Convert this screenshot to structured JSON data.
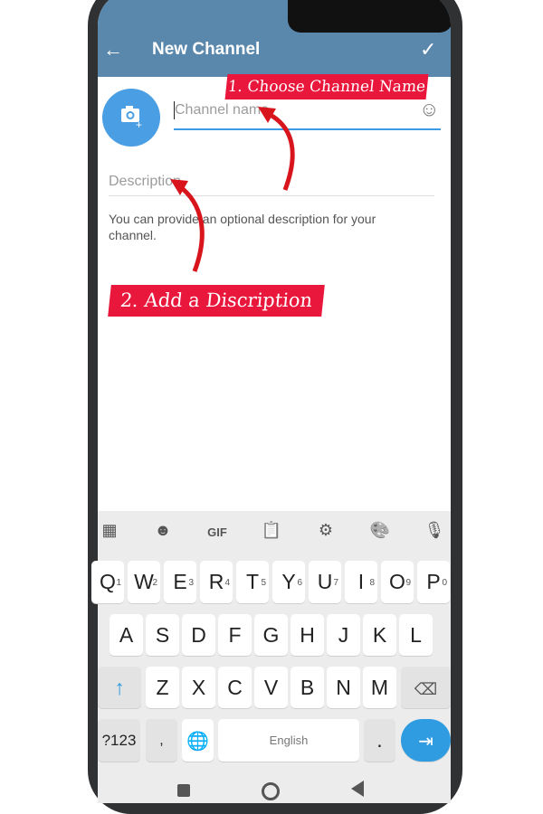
{
  "header": {
    "title": "New Channel",
    "back_icon": "arrow-left-icon",
    "confirm_icon": "check-icon",
    "color": "#5a87ac"
  },
  "form": {
    "channel_name_placeholder": "Channel name",
    "description_placeholder": "Description",
    "help_text": "You can provide an optional description for your channel."
  },
  "annotations": {
    "step1": "1. Choose Channel Name",
    "step2": "2. Add a Discription",
    "color": "#e8173b"
  },
  "keyboard": {
    "toolbar": [
      "apps-icon",
      "sticker-icon",
      "GIF",
      "clipboard-icon",
      "settings-icon",
      "palette-icon",
      "mic-icon"
    ],
    "row1": [
      [
        "Q",
        "1"
      ],
      [
        "W",
        "2"
      ],
      [
        "E",
        "3"
      ],
      [
        "R",
        "4"
      ],
      [
        "T",
        "5"
      ],
      [
        "Y",
        "6"
      ],
      [
        "U",
        "7"
      ],
      [
        "I",
        "8"
      ],
      [
        "O",
        "9"
      ],
      [
        "P",
        "0"
      ]
    ],
    "row2": [
      "A",
      "S",
      "D",
      "F",
      "G",
      "H",
      "J",
      "K",
      "L"
    ],
    "row3": [
      "Z",
      "X",
      "C",
      "V",
      "B",
      "N",
      "M"
    ],
    "symbols": "?123",
    "comma": ",",
    "space": "English",
    "period": ".",
    "accent": "#2f9be0"
  }
}
